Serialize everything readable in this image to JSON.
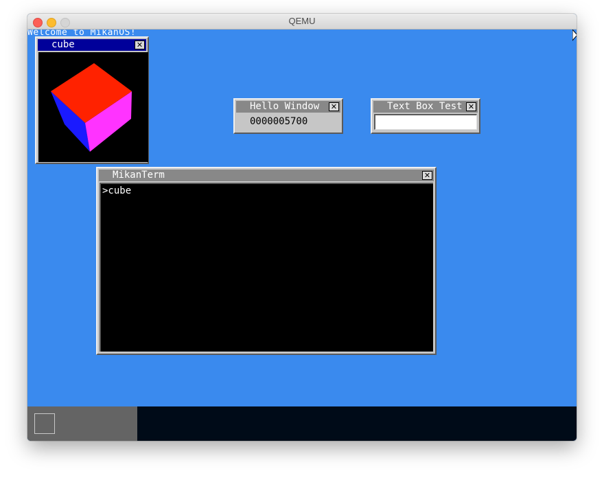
{
  "host": {
    "title": "QEMU"
  },
  "screen": {
    "welcome_text": "Welcome to MikanOS!",
    "background_color": "#3a8aee"
  },
  "windows": {
    "cube": {
      "title": "cube",
      "close_glyph": "✕",
      "cube_colors": {
        "top": "#ff2200",
        "left": "#1a1aff",
        "right": "#ff33ff"
      }
    },
    "hello": {
      "title": "Hello Window",
      "close_glyph": "✕",
      "counter": "0000005700"
    },
    "textbox_test": {
      "title": "Text Box Test",
      "close_glyph": "✕",
      "input_value": ""
    },
    "terminal": {
      "title": "MikanTerm",
      "close_glyph": "✕",
      "lines": [
        ">cube"
      ]
    }
  },
  "taskbar": {
    "start_icon": "square-icon"
  }
}
